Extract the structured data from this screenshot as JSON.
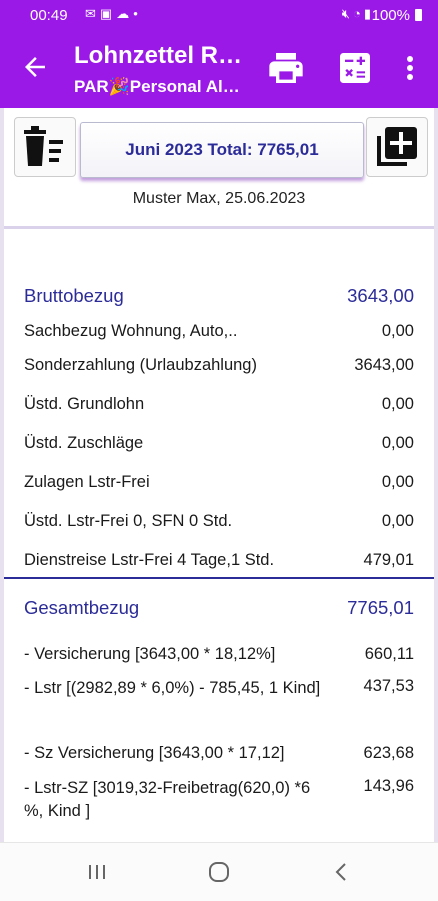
{
  "status_bar": {
    "time": "00:49",
    "battery": "100%",
    "icons_left": [
      "messages-icon",
      "gallery-icon",
      "cloud-icon",
      "dot-icon"
    ],
    "icons_right": [
      "mute-icon",
      "wifi-icon",
      "signal-icon",
      "battery-icon"
    ]
  },
  "app_bar": {
    "title": "Lohnzettel R…",
    "subtitle": "PAR🎉Personal Al…",
    "accent_color": "#9b19e6"
  },
  "toolbar": {
    "total_label": "Juni 2023 Total: 7765,01",
    "date_line": "Muster Max, 25.06.2023"
  },
  "brutto": {
    "header": {
      "label": "Bruttobezug",
      "value": "3643,00"
    },
    "rows": [
      {
        "label": "Sachbezug Wohnung, Auto,..",
        "value": "0,00"
      },
      {
        "label": "Sonderzahlung (Urlaubzahlung)",
        "value": "3643,00"
      },
      {
        "label": "Üstd. Grundlohn",
        "value": "0,00"
      },
      {
        "label": "Üstd. Zuschläge",
        "value": "0,00"
      },
      {
        "label": "Zulagen Lstr-Frei",
        "value": "0,00"
      },
      {
        "label": "Üstd. Lstr-Frei 0, SFN 0 Std.",
        "value": "0,00"
      },
      {
        "label": "Dienstreise Lstr-Frei 4 Tage,1 Std.",
        "value": "479,01"
      }
    ]
  },
  "gesamt": {
    "header": {
      "label": "Gesamtbezug",
      "value": "7765,01"
    },
    "rows": [
      {
        "label": "- Versicherung [3643,00 * 18,12%]",
        "value": "660,11"
      },
      {
        "label": "- Lstr [(2982,89 * 6,0%) - 785,45, 1 Kind]",
        "value": "437,53"
      },
      {
        "label": "- Sz Versicherung [3643,00 * 17,12]",
        "value": "623,68"
      },
      {
        "label": "- Lstr-SZ [3019,32-Freibetrag(620,0) *6 %, Kind ]",
        "value": "143,96"
      }
    ]
  },
  "colors": {
    "accent": "#9b19e6",
    "section_blue": "#2c2c99"
  }
}
